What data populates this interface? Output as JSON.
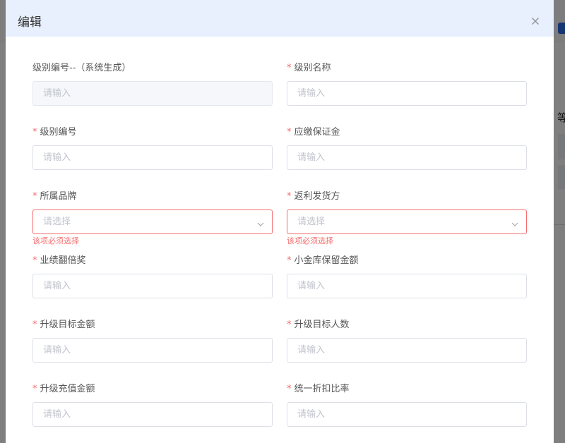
{
  "dialog": {
    "title": "编辑"
  },
  "fields": {
    "level_code_auto": {
      "label": "级别编号--（系统生成）",
      "placeholder": "请输入"
    },
    "level_name": {
      "label": "级别名称",
      "placeholder": "请输入"
    },
    "level_code": {
      "label": "级别编号",
      "placeholder": "请输入"
    },
    "deposit": {
      "label": "应缴保证金",
      "placeholder": "请输入"
    },
    "brand": {
      "label": "所属品牌",
      "placeholder": "请选择",
      "error": "该项必须选择"
    },
    "rebate_shipper": {
      "label": "返利发货方",
      "placeholder": "请选择",
      "error": "该项必须选择"
    },
    "performance_double": {
      "label": "业绩翻倍奖",
      "placeholder": "请输入"
    },
    "vault_reserve": {
      "label": "小金库保留金额",
      "placeholder": "请输入"
    },
    "upgrade_target_amount": {
      "label": "升级目标金额",
      "placeholder": "请输入"
    },
    "upgrade_target_people": {
      "label": "升级目标人数",
      "placeholder": "请输入"
    },
    "upgrade_recharge": {
      "label": "升级充值金额",
      "placeholder": "请输入"
    },
    "unified_discount": {
      "label": "统一折扣比率",
      "placeholder": "请输入"
    }
  },
  "required_mark": "*",
  "background": {
    "partial_text": "等"
  },
  "colors": {
    "header_bg": "#e8f0fd",
    "error": "#f56c6c",
    "border": "#dcdfe6",
    "placeholder": "#c0c4cc",
    "disabled_bg": "#f5f7fa"
  },
  "icons": {
    "close": "close-icon",
    "select_arrow": "chevron-down-icon"
  }
}
